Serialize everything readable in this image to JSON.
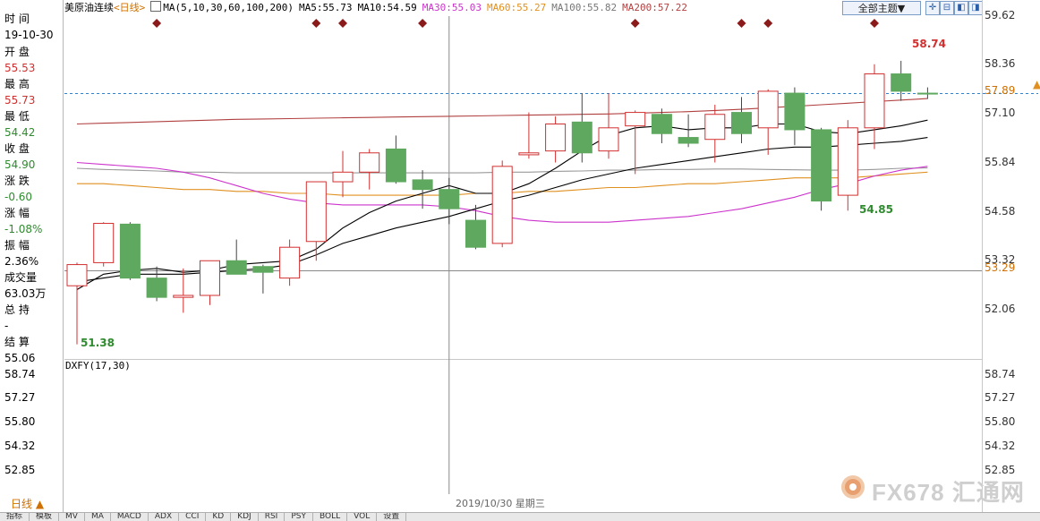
{
  "info_panel": {
    "time_label": "时 间",
    "date": "19-10-30",
    "open_label": "开 盘",
    "open": "55.53",
    "high_label": "最 高",
    "high": "55.73",
    "low_label": "最 低",
    "low": "54.42",
    "close_label": "收 盘",
    "close": "54.90",
    "change_label": "涨 跌",
    "change": "-0.60",
    "pct_label": "涨 幅",
    "pct": "-1.08%",
    "amp_label": "振 幅",
    "amp": "2.36%",
    "vol_label": "成交量",
    "vol": "63.03万",
    "oi_label": "总 持",
    "oi": "-",
    "settle_label": "结 算",
    "settle": "55.06"
  },
  "header": {
    "instrument": "美原油连续",
    "period": "<日线>",
    "ma_spec": "MA(5,10,30,60,100,200)",
    "ma5": "MA5:55.73",
    "ma10": "MA10:54.59",
    "ma30": "MA30:55.03",
    "ma60": "MA60:55.27",
    "ma100": "MA100:55.82",
    "ma200": "MA200:57.22",
    "theme_button": "全部主题▼"
  },
  "colors": {
    "up": "#d23030",
    "down": "#5fa85f",
    "ma5": "#000000",
    "ma10": "#000000",
    "ma30": "#cc33cc",
    "ma60": "#e09020",
    "ma100": "#999999",
    "ma200": "#b04040"
  },
  "main_axis_labels": [
    "59.62",
    "58.36",
    "57.10",
    "55.84",
    "54.58",
    "53.32",
    "52.06"
  ],
  "current_price_label": "57.89",
  "ref_line_label": "53.29",
  "high_annotation": "58.74",
  "low_annotation": "54.85",
  "start_low_annotation": "51.38",
  "sub_indicator": {
    "title": "DXFY(17,30)",
    "axis_labels": [
      "58.74",
      "57.27",
      "55.80",
      "54.32",
      "52.85"
    ],
    "left_axis_labels": [
      "58.74",
      "57.27",
      "55.80",
      "54.32",
      "52.85"
    ]
  },
  "crosshair_date": "2019/10/30  星期三",
  "bottom_tab": "日线 ▲",
  "indicator_tabs": [
    "指标",
    "模板",
    "MV",
    "MA",
    "MACD",
    "ADX",
    "CCI",
    "KD",
    "KDJ",
    "RSI",
    "PSY",
    "BOLL",
    "VOL",
    "设置"
  ],
  "logo": "FX678 汇通网",
  "chart_data": {
    "type": "candlestick",
    "ylim": [
      51.0,
      59.9
    ],
    "candles": [
      {
        "o": 52.9,
        "h": 53.5,
        "l": 51.38,
        "c": 53.45
      },
      {
        "o": 53.5,
        "h": 54.55,
        "l": 53.4,
        "c": 54.52
      },
      {
        "o": 54.5,
        "h": 54.55,
        "l": 53.05,
        "c": 53.1
      },
      {
        "o": 53.1,
        "h": 53.4,
        "l": 52.5,
        "c": 52.6
      },
      {
        "o": 52.6,
        "h": 53.35,
        "l": 52.2,
        "c": 52.65
      },
      {
        "o": 52.65,
        "h": 53.5,
        "l": 52.4,
        "c": 53.55
      },
      {
        "o": 53.55,
        "h": 54.1,
        "l": 53.2,
        "c": 53.2
      },
      {
        "o": 53.4,
        "h": 53.45,
        "l": 52.7,
        "c": 53.25
      },
      {
        "o": 53.1,
        "h": 54.1,
        "l": 52.9,
        "c": 53.9
      },
      {
        "o": 54.05,
        "h": 55.45,
        "l": 53.55,
        "c": 55.6
      },
      {
        "o": 55.6,
        "h": 56.4,
        "l": 55.2,
        "c": 55.85
      },
      {
        "o": 55.85,
        "h": 56.45,
        "l": 55.4,
        "c": 56.35
      },
      {
        "o": 56.45,
        "h": 56.8,
        "l": 55.55,
        "c": 55.6
      },
      {
        "o": 55.65,
        "h": 55.9,
        "l": 54.9,
        "c": 55.4
      },
      {
        "o": 55.4,
        "h": 55.7,
        "l": 54.5,
        "c": 54.9
      },
      {
        "o": 54.6,
        "h": 55.0,
        "l": 53.85,
        "c": 53.9
      },
      {
        "o": 54.0,
        "h": 56.15,
        "l": 53.9,
        "c": 56.0
      },
      {
        "o": 56.3,
        "h": 57.4,
        "l": 56.2,
        "c": 56.35
      },
      {
        "o": 56.4,
        "h": 57.3,
        "l": 56.1,
        "c": 57.1
      },
      {
        "o": 57.15,
        "h": 57.9,
        "l": 56.1,
        "c": 56.35
      },
      {
        "o": 56.4,
        "h": 57.9,
        "l": 56.2,
        "c": 57.0
      },
      {
        "o": 57.05,
        "h": 57.45,
        "l": 55.8,
        "c": 57.4
      },
      {
        "o": 57.35,
        "h": 57.5,
        "l": 56.6,
        "c": 56.85
      },
      {
        "o": 56.75,
        "h": 57.35,
        "l": 56.5,
        "c": 56.6
      },
      {
        "o": 56.7,
        "h": 57.6,
        "l": 56.1,
        "c": 57.35
      },
      {
        "o": 57.4,
        "h": 57.8,
        "l": 56.6,
        "c": 56.85
      },
      {
        "o": 57.0,
        "h": 58.0,
        "l": 56.3,
        "c": 57.95
      },
      {
        "o": 57.9,
        "h": 58.05,
        "l": 56.55,
        "c": 56.95
      },
      {
        "o": 56.95,
        "h": 57.0,
        "l": 54.85,
        "c": 55.1
      },
      {
        "o": 55.25,
        "h": 57.2,
        "l": 54.85,
        "c": 57.0
      },
      {
        "o": 57.0,
        "h": 58.65,
        "l": 56.45,
        "c": 58.4
      },
      {
        "o": 58.4,
        "h": 58.74,
        "l": 57.7,
        "c": 57.95
      },
      {
        "o": 57.9,
        "h": 58.05,
        "l": 57.75,
        "c": 57.89
      }
    ],
    "ma_lines": {
      "ma5": [
        52.8,
        53.2,
        53.3,
        53.35,
        53.25,
        53.3,
        53.45,
        53.5,
        53.55,
        53.85,
        54.4,
        54.8,
        55.1,
        55.3,
        55.5,
        55.3,
        55.3,
        55.55,
        55.95,
        56.4,
        56.8,
        57.0,
        57.05,
        56.95,
        57.0,
        57.0,
        57.1,
        57.1,
        56.9,
        56.85,
        56.95,
        57.05,
        57.2
      ],
      "ma10": [
        53.0,
        53.1,
        53.2,
        53.2,
        53.2,
        53.25,
        53.3,
        53.35,
        53.45,
        53.7,
        54.0,
        54.2,
        54.4,
        54.55,
        54.7,
        54.9,
        55.1,
        55.25,
        55.45,
        55.65,
        55.8,
        55.95,
        56.05,
        56.15,
        56.25,
        56.35,
        56.45,
        56.5,
        56.5,
        56.55,
        56.6,
        56.65,
        56.75
      ],
      "ma30": [
        56.1,
        56.05,
        56.0,
        55.95,
        55.85,
        55.7,
        55.5,
        55.3,
        55.15,
        55.05,
        55.0,
        55.0,
        55.0,
        55.0,
        54.95,
        54.85,
        54.7,
        54.6,
        54.55,
        54.55,
        54.55,
        54.6,
        54.65,
        54.7,
        54.8,
        54.9,
        55.05,
        55.2,
        55.4,
        55.55,
        55.75,
        55.9,
        56.0
      ],
      "ma60": [
        55.55,
        55.55,
        55.5,
        55.45,
        55.4,
        55.4,
        55.35,
        55.35,
        55.3,
        55.3,
        55.25,
        55.25,
        55.25,
        55.25,
        55.25,
        55.3,
        55.3,
        55.35,
        55.35,
        55.4,
        55.45,
        55.45,
        55.5,
        55.55,
        55.55,
        55.6,
        55.65,
        55.7,
        55.7,
        55.7,
        55.75,
        55.8,
        55.85
      ],
      "ma100": [
        55.95,
        55.92,
        55.9,
        55.88,
        55.85,
        55.85,
        55.83,
        55.83,
        55.83,
        55.83,
        55.83,
        55.83,
        55.83,
        55.83,
        55.83,
        55.83,
        55.85,
        55.85,
        55.87,
        55.88,
        55.9,
        55.9,
        55.92,
        55.92,
        55.93,
        55.93,
        55.92,
        55.91,
        55.9,
        55.9,
        55.92,
        55.95,
        55.96
      ],
      "ma200": [
        57.1,
        57.12,
        57.14,
        57.16,
        57.18,
        57.2,
        57.22,
        57.23,
        57.24,
        57.25,
        57.26,
        57.27,
        57.28,
        57.29,
        57.3,
        57.31,
        57.32,
        57.33,
        57.34,
        57.35,
        57.36,
        57.38,
        57.4,
        57.42,
        57.45,
        57.48,
        57.52,
        57.56,
        57.6,
        57.64,
        57.68,
        57.72,
        57.76
      ]
    },
    "markers_at_candles": [
      3,
      9,
      10,
      13,
      21,
      25,
      26,
      30
    ],
    "crosshair_candle": 14,
    "current_price": 57.89,
    "ref_price": 53.29
  }
}
